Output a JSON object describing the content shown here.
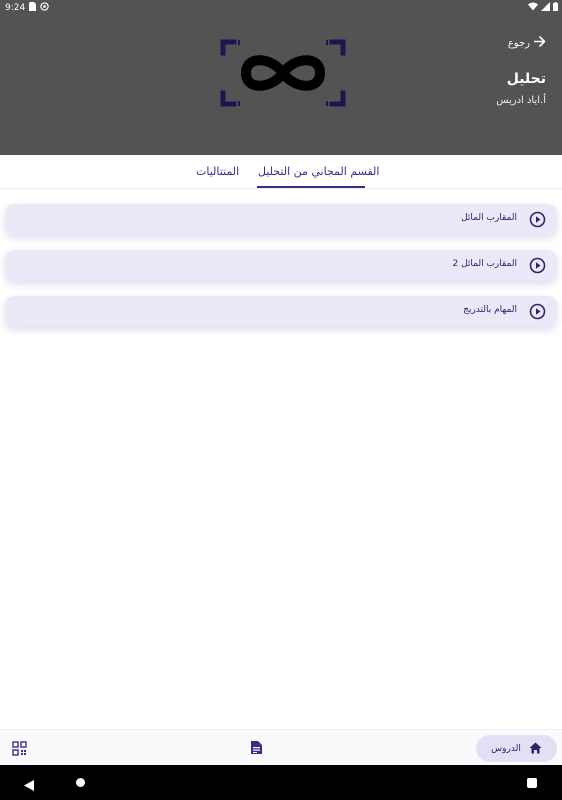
{
  "status_bar": {
    "time": "9:24"
  },
  "header": {
    "back_label": "رجوع",
    "course_title": "تحليل",
    "course_author": "أ.اياد ادريس"
  },
  "tabs": [
    {
      "label": "القسم المجاني من التحليل",
      "active": true
    },
    {
      "label": "المتتاليات",
      "active": false
    }
  ],
  "lessons": [
    {
      "title": "المقارب المائل"
    },
    {
      "title": "المقارب المائل 2"
    },
    {
      "title": "المهام بالتدريج"
    }
  ],
  "bottom_nav": {
    "home_label": "الدروس"
  },
  "colors": {
    "header_bg": "#535353",
    "accent": "#3a2c8c",
    "lesson_bg": "#ebe9f8",
    "logo_frame": "#1c1650"
  }
}
